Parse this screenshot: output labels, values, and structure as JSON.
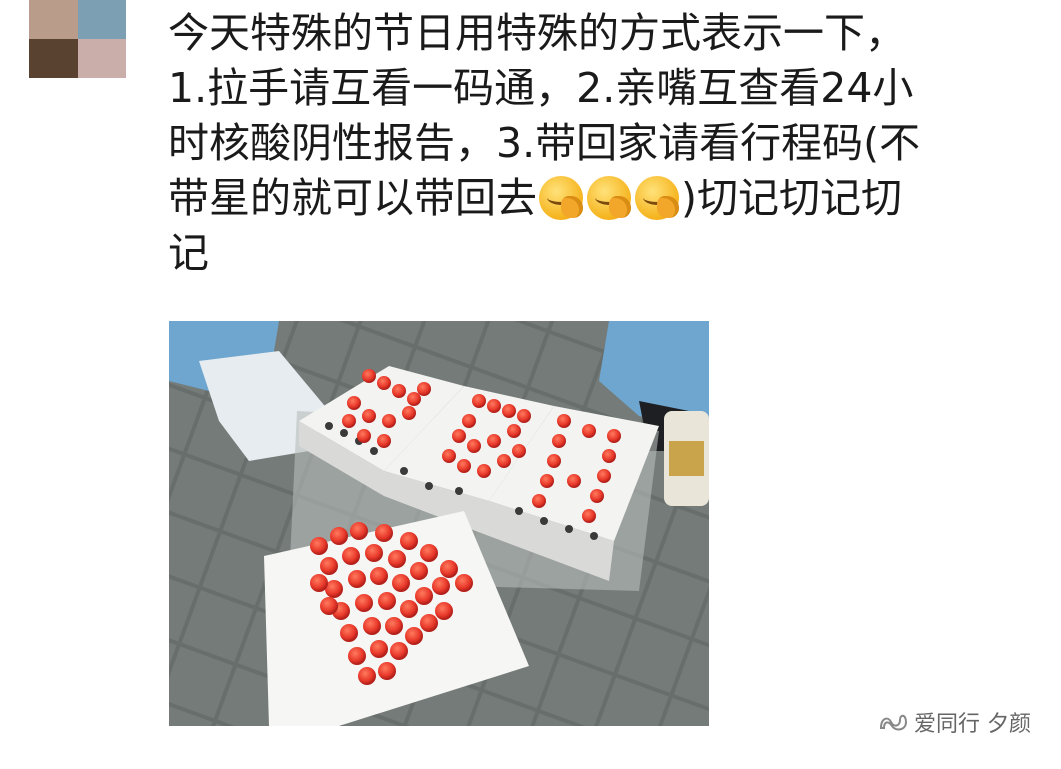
{
  "post": {
    "lines": [
      "今天特殊的节日用特殊的方式表示一下，",
      "1.拉手请互看一码通，2.亲嘴互查看24小",
      "时核酸阴性报告，3.带回家请看行程码(不",
      "带星的就可以带回去",
      ")切记切记切",
      "记"
    ]
  },
  "avatar": {
    "colors": [
      "#b99d8a",
      "#7d9fb3",
      "#5a4231",
      "#c9aeaa"
    ]
  },
  "photo": {
    "tube_color": "#e8382a"
  },
  "watermark": {
    "text": "爱同行 夕颜"
  },
  "icons": {
    "emoji": "face-palm-emoji",
    "watermark": "wechat-channel-icon"
  }
}
